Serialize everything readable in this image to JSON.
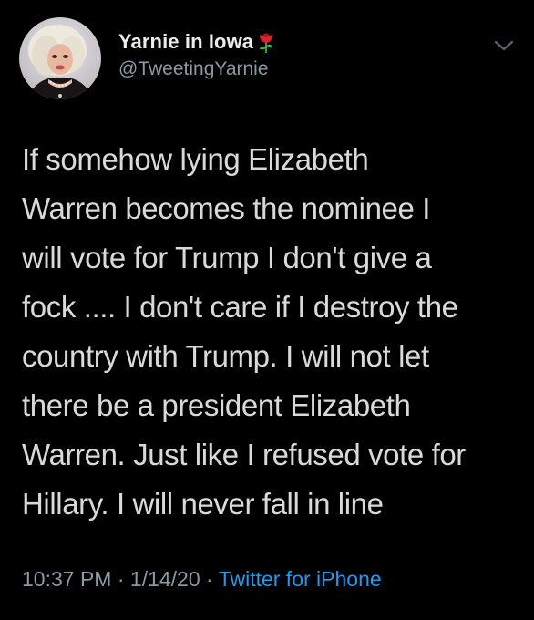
{
  "user": {
    "display_name": "Yarnie in Iowa",
    "handle": "@TweetingYarnie",
    "name_emoji": "rose-icon"
  },
  "tweet": {
    "lines": [
      "If somehow lying Elizabeth",
      "Warren becomes the nominee I",
      "will vote for Trump I don't give a",
      "fock .... I don't care if I destroy the",
      "country with Trump. I will not let",
      "there be a president Elizabeth",
      "Warren. Just like I refused vote for",
      "Hillary. I will never fall in line"
    ]
  },
  "meta": {
    "time": "10:37 PM",
    "separator": " · ",
    "date": "1/14/20",
    "source": "Twitter for iPhone"
  },
  "colors": {
    "background": "#000000",
    "text": "#d9d9d9",
    "secondary": "#8b98a5",
    "link": "#1d9bf0"
  }
}
